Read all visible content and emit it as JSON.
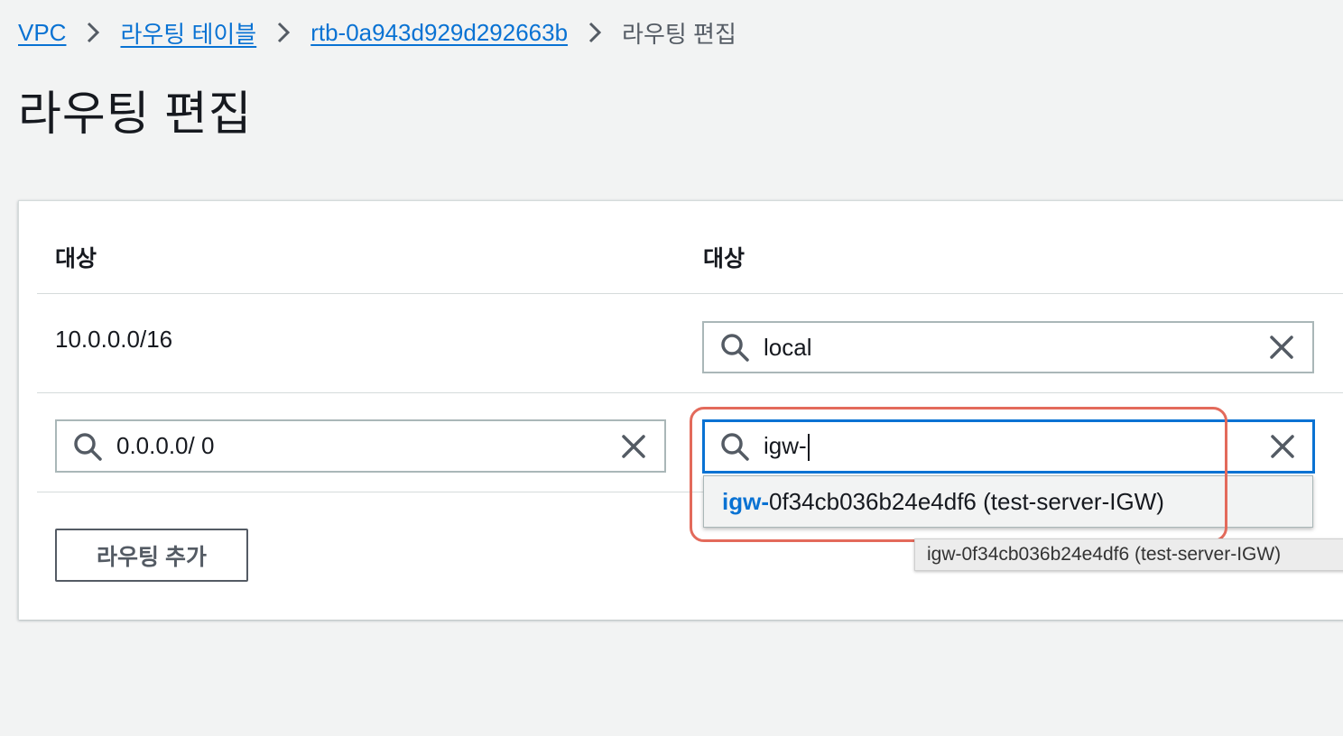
{
  "breadcrumb": {
    "items": [
      "VPC",
      "라우팅 테이블",
      "rtb-0a943d929d292663b"
    ],
    "current": "라우팅 편집"
  },
  "page_title": "라우팅 편집",
  "table": {
    "col1_header": "대상",
    "col2_header": "대상",
    "rows": [
      {
        "destination": "10.0.0.0/16",
        "target": "local"
      },
      {
        "destination": "0.0.0.0/ 0",
        "target": "igw-"
      }
    ]
  },
  "dropdown": {
    "match": "igw-",
    "rest": "0f34cb036b24e4df6 (test-server-IGW)"
  },
  "tooltip": "igw-0f34cb036b24e4df6 (test-server-IGW)",
  "add_route_label": "라우팅 추가",
  "colors": {
    "link": "#0972d3",
    "focus": "#0972d3",
    "highlight": "#e36a5b",
    "background": "#f2f3f3"
  },
  "icons": [
    "chevron-right-icon",
    "search-icon",
    "close-icon"
  ]
}
